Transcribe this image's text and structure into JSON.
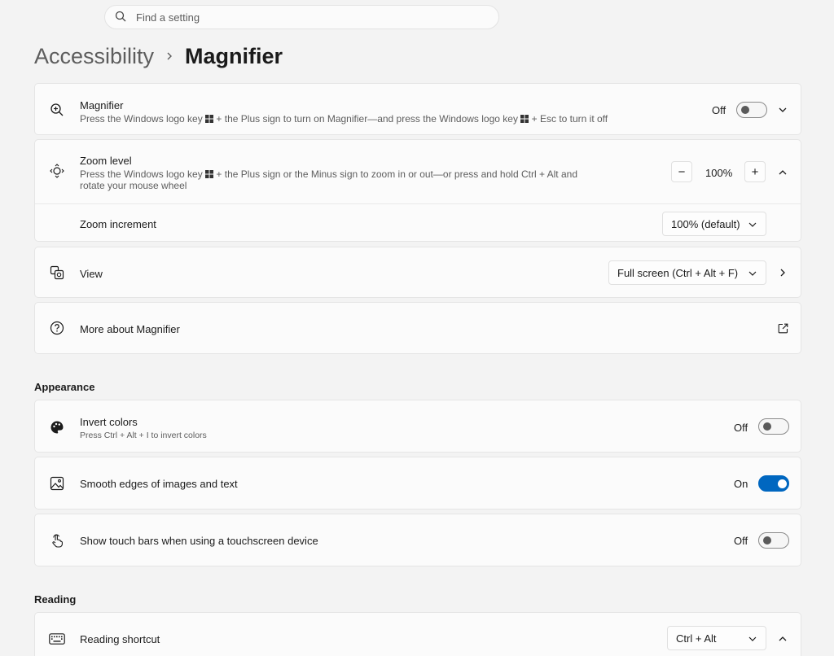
{
  "search": {
    "placeholder": "Find a setting",
    "icon": "search-icon"
  },
  "breadcrumb": {
    "parent": "Accessibility",
    "separator": "›",
    "current": "Magnifier"
  },
  "magnifier": {
    "title": "Magnifier",
    "desc_a": "Press the Windows logo key",
    "desc_b": "+ the Plus sign to turn on Magnifier—and press the Windows logo key",
    "desc_c": "+ Esc to turn it off",
    "state": "Off",
    "toggle_on": false
  },
  "zoom": {
    "title": "Zoom level",
    "desc_a": "Press the Windows logo key",
    "desc_b": "+ the Plus sign or the Minus sign to zoom in or out—or press and hold Ctrl + Alt and",
    "desc_line2": "rotate your mouse wheel",
    "value": "100%",
    "minus": "−",
    "plus": "+",
    "increment_label": "Zoom increment",
    "increment_value": "100% (default)"
  },
  "view": {
    "title": "View",
    "value": "Full screen (Ctrl + Alt + F)"
  },
  "more": {
    "title": "More about Magnifier"
  },
  "appearance": {
    "heading": "Appearance",
    "invert": {
      "title": "Invert colors",
      "desc": "Press Ctrl + Alt + I to invert colors",
      "state": "Off",
      "toggle_on": false
    },
    "smooth": {
      "title": "Smooth edges of images and text",
      "state": "On",
      "toggle_on": true
    },
    "touch": {
      "title": "Show touch bars when using a touchscreen device",
      "state": "Off",
      "toggle_on": false
    }
  },
  "reading": {
    "heading": "Reading",
    "shortcut": {
      "title": "Reading shortcut",
      "value": "Ctrl + Alt"
    }
  },
  "colors": {
    "accent": "#0067c0",
    "background": "#f3f3f3",
    "card": "#fbfbfb"
  }
}
